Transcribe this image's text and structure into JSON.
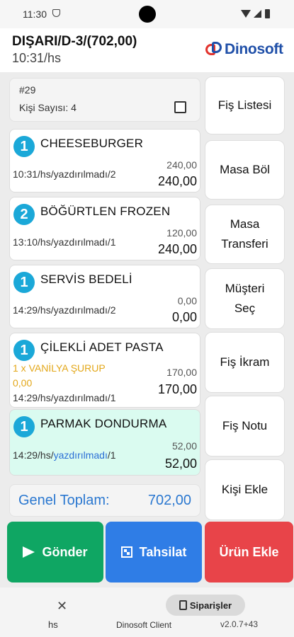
{
  "statusbar": {
    "time": "11:30"
  },
  "header": {
    "title": "DIŞARI/D-3/(702,00)",
    "subtitle": "10:31/hs",
    "logo_text": "Dinosoft"
  },
  "ticket": {
    "number": "#29",
    "persons": "Kişi Sayısı: 4"
  },
  "items": [
    {
      "qty": "1",
      "name": "CHEESEBURGER",
      "meta_prefix": "10:31/hs/",
      "status": "yazdırılmadı",
      "meta_suffix": "/2",
      "unit": "240,00",
      "total": "240,00"
    },
    {
      "qty": "2",
      "name": "BÖĞÜRTLEN FROZEN",
      "meta_prefix": "13:10/hs/",
      "status": "yazdırılmadı",
      "meta_suffix": "/1",
      "unit": "120,00",
      "total": "240,00"
    },
    {
      "qty": "1",
      "name": "SERVİS BEDELİ",
      "meta_prefix": "14:29/hs/",
      "status": "yazdırılmadı",
      "meta_suffix": "/2",
      "unit": "0,00",
      "total": "0,00"
    },
    {
      "qty": "1",
      "name": "ÇİLEKLİ ADET PASTA",
      "extra_name": "1 x VANİLYA ŞURUP",
      "extra_price": "0,00",
      "meta_prefix": "14:29/hs/",
      "status": "yazdırılmadı",
      "meta_suffix": "/1",
      "unit": "170,00",
      "total": "170,00"
    },
    {
      "qty": "1",
      "name": "PARMAK DONDURMA",
      "meta_prefix": "14:29/hs/",
      "status": "yazdırılmadı",
      "meta_suffix": "/1",
      "unit": "52,00",
      "total": "52,00"
    }
  ],
  "grand_total": {
    "label": "Genel Toplam:",
    "value": "702,00"
  },
  "side_buttons": [
    "Fiş Listesi",
    "Masa Böl",
    "Masa\nTransferi",
    "Müşteri\nSeç",
    "Fiş İkram",
    "Fiş Notu",
    "Kişi Ekle"
  ],
  "actions": {
    "send": "Gönder",
    "pay": "Tahsilat",
    "add": "Ürün Ekle"
  },
  "bottom_nav": {
    "hs_label": "hs",
    "orders_label": "Siparişler",
    "client_label": "Dinosoft Client",
    "version": "v2.0.7+43"
  },
  "colors": {
    "accent_blue": "#1ba8d8",
    "send_green": "#0fa663",
    "pay_blue": "#2f7de6",
    "add_red": "#e84449",
    "extra_orange": "#e3a719",
    "highlight_mint": "#dafbf0"
  }
}
